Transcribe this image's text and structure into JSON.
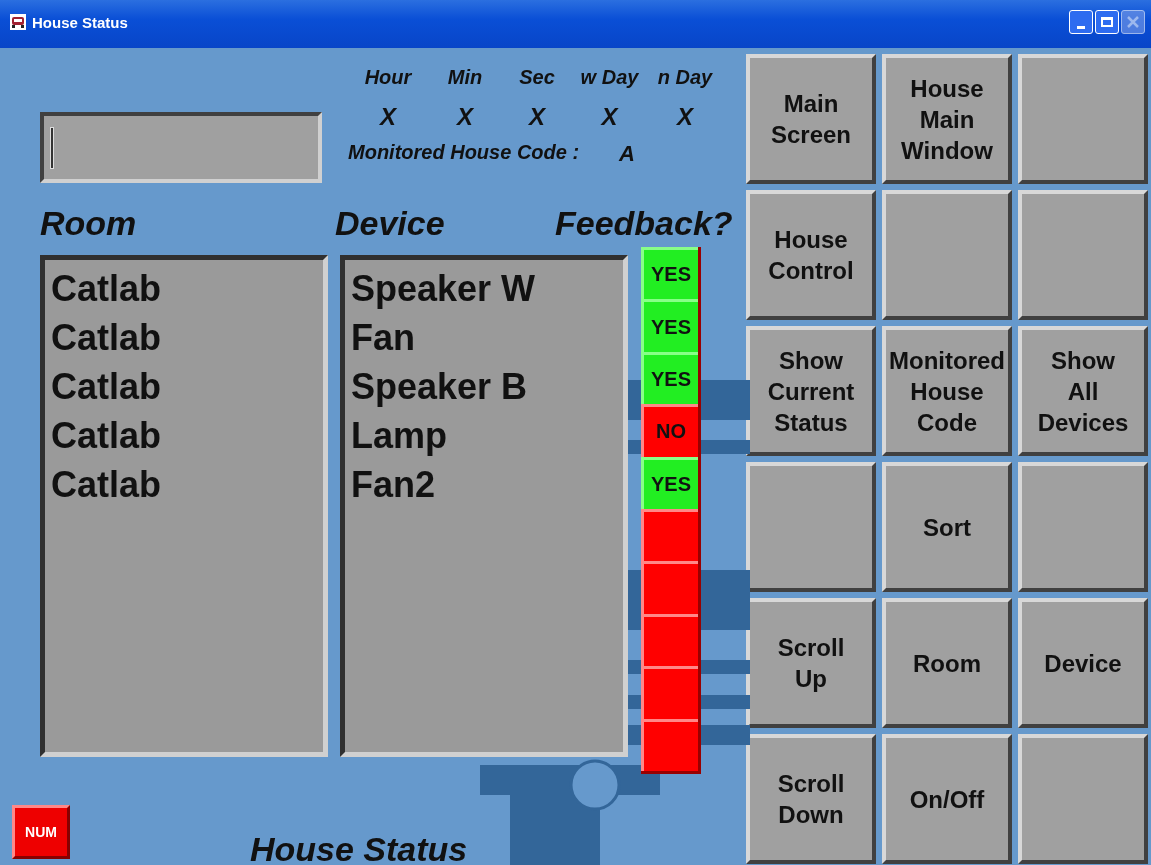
{
  "window": {
    "title": "House Status",
    "close_disabled": true
  },
  "clock": {
    "columns": [
      {
        "label": "Hour",
        "value": "X"
      },
      {
        "label": "Min",
        "value": "X"
      },
      {
        "label": "Sec",
        "value": "X"
      },
      {
        "label": "w Day",
        "value": "X"
      },
      {
        "label": "n Day",
        "value": "X"
      }
    ],
    "house_code": {
      "label": "Monitored House Code :",
      "value": "A"
    }
  },
  "headings": {
    "room": "Room",
    "device": "Device",
    "feedback": "Feedback?"
  },
  "rooms": [
    "Catlab",
    "Catlab",
    "Catlab",
    "Catlab",
    "Catlab"
  ],
  "devices": [
    "Speaker W",
    "Fan",
    "Speaker B",
    "Lamp",
    "Fan2"
  ],
  "feedback": [
    {
      "kind": "yes",
      "label": "YES"
    },
    {
      "kind": "yes",
      "label": "YES"
    },
    {
      "kind": "yes",
      "label": "YES"
    },
    {
      "kind": "no",
      "label": "NO"
    },
    {
      "kind": "yes",
      "label": "YES"
    },
    {
      "kind": "empty"
    },
    {
      "kind": "empty"
    },
    {
      "kind": "empty"
    },
    {
      "kind": "empty"
    },
    {
      "kind": "empty"
    }
  ],
  "buttons": [
    {
      "kind": "command",
      "label": "Main\nScreen"
    },
    {
      "kind": "command",
      "label": "House\nMain\nWindow"
    },
    {
      "kind": "blank"
    },
    {
      "kind": "command",
      "label": "House\nControl"
    },
    {
      "kind": "blank"
    },
    {
      "kind": "blank"
    },
    {
      "kind": "command",
      "label": "Show\nCurrent\nStatus"
    },
    {
      "kind": "command",
      "label": "Monitored\nHouse\nCode"
    },
    {
      "kind": "command",
      "label": "Show\nAll\nDevices"
    },
    {
      "kind": "blank"
    },
    {
      "kind": "command",
      "label": "Sort"
    },
    {
      "kind": "blank"
    },
    {
      "kind": "command",
      "label": "Scroll\nUp"
    },
    {
      "kind": "command",
      "label": "Room"
    },
    {
      "kind": "command",
      "label": "Device"
    },
    {
      "kind": "command",
      "label": "Scroll\nDown"
    },
    {
      "kind": "command",
      "label": "On/Off"
    },
    {
      "kind": "blank"
    }
  ],
  "num_indicator": "NUM",
  "footer_title": "House Status"
}
